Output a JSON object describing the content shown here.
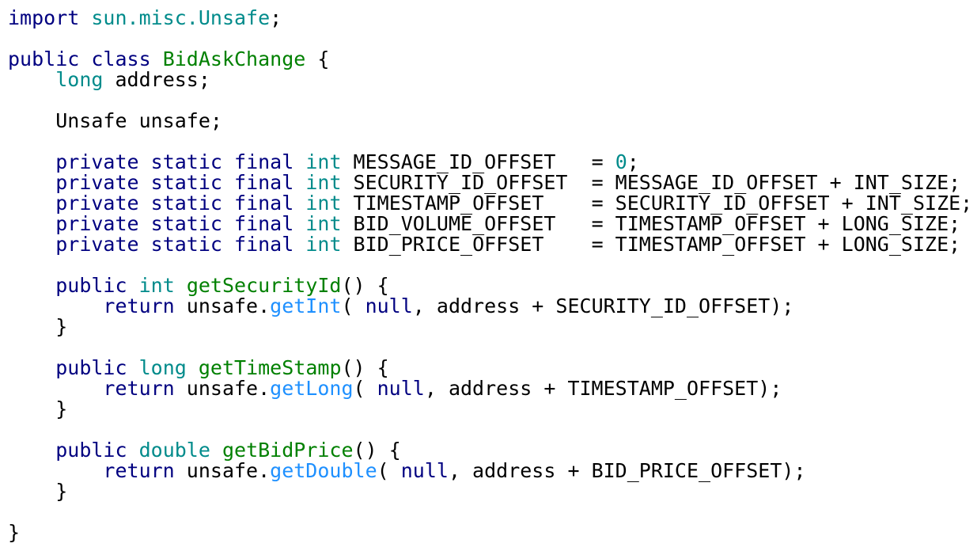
{
  "colors": {
    "keyword": "#000080",
    "type": "#008b8b",
    "class_name": "#008000",
    "method_name": "#008000",
    "call": "#1e90ff",
    "number": "#008b8b",
    "package": "#008b8b",
    "plain": "#000000",
    "background": "#ffffff"
  },
  "code_lines": [
    [
      {
        "t": "keyword",
        "v": "import"
      },
      {
        "t": "plain",
        "v": " "
      },
      {
        "t": "package",
        "v": "sun.misc.Unsafe"
      },
      {
        "t": "plain",
        "v": ";"
      }
    ],
    [],
    [
      {
        "t": "keyword",
        "v": "public"
      },
      {
        "t": "plain",
        "v": " "
      },
      {
        "t": "keyword",
        "v": "class"
      },
      {
        "t": "plain",
        "v": " "
      },
      {
        "t": "class",
        "v": "BidAskChange"
      },
      {
        "t": "plain",
        "v": " {"
      }
    ],
    [
      {
        "t": "plain",
        "v": "    "
      },
      {
        "t": "type",
        "v": "long"
      },
      {
        "t": "plain",
        "v": " address;"
      }
    ],
    [],
    [
      {
        "t": "plain",
        "v": "    Unsafe unsafe;"
      }
    ],
    [],
    [
      {
        "t": "plain",
        "v": "    "
      },
      {
        "t": "keyword",
        "v": "private"
      },
      {
        "t": "plain",
        "v": " "
      },
      {
        "t": "keyword",
        "v": "static"
      },
      {
        "t": "plain",
        "v": " "
      },
      {
        "t": "keyword",
        "v": "final"
      },
      {
        "t": "plain",
        "v": " "
      },
      {
        "t": "type",
        "v": "int"
      },
      {
        "t": "plain",
        "v": " MESSAGE_ID_OFFSET   = "
      },
      {
        "t": "number",
        "v": "0"
      },
      {
        "t": "plain",
        "v": ";"
      }
    ],
    [
      {
        "t": "plain",
        "v": "    "
      },
      {
        "t": "keyword",
        "v": "private"
      },
      {
        "t": "plain",
        "v": " "
      },
      {
        "t": "keyword",
        "v": "static"
      },
      {
        "t": "plain",
        "v": " "
      },
      {
        "t": "keyword",
        "v": "final"
      },
      {
        "t": "plain",
        "v": " "
      },
      {
        "t": "type",
        "v": "int"
      },
      {
        "t": "plain",
        "v": " SECURITY_ID_OFFSET  = MESSAGE_ID_OFFSET + INT_SIZE;"
      }
    ],
    [
      {
        "t": "plain",
        "v": "    "
      },
      {
        "t": "keyword",
        "v": "private"
      },
      {
        "t": "plain",
        "v": " "
      },
      {
        "t": "keyword",
        "v": "static"
      },
      {
        "t": "plain",
        "v": " "
      },
      {
        "t": "keyword",
        "v": "final"
      },
      {
        "t": "plain",
        "v": " "
      },
      {
        "t": "type",
        "v": "int"
      },
      {
        "t": "plain",
        "v": " TIMESTAMP_OFFSET    = SECURITY_ID_OFFSET + INT_SIZE;"
      }
    ],
    [
      {
        "t": "plain",
        "v": "    "
      },
      {
        "t": "keyword",
        "v": "private"
      },
      {
        "t": "plain",
        "v": " "
      },
      {
        "t": "keyword",
        "v": "static"
      },
      {
        "t": "plain",
        "v": " "
      },
      {
        "t": "keyword",
        "v": "final"
      },
      {
        "t": "plain",
        "v": " "
      },
      {
        "t": "type",
        "v": "int"
      },
      {
        "t": "plain",
        "v": " BID_VOLUME_OFFSET   = TIMESTAMP_OFFSET + LONG_SIZE;"
      }
    ],
    [
      {
        "t": "plain",
        "v": "    "
      },
      {
        "t": "keyword",
        "v": "private"
      },
      {
        "t": "plain",
        "v": " "
      },
      {
        "t": "keyword",
        "v": "static"
      },
      {
        "t": "plain",
        "v": " "
      },
      {
        "t": "keyword",
        "v": "final"
      },
      {
        "t": "plain",
        "v": " "
      },
      {
        "t": "type",
        "v": "int"
      },
      {
        "t": "plain",
        "v": " BID_PRICE_OFFSET    = TIMESTAMP_OFFSET + LONG_SIZE;"
      }
    ],
    [],
    [
      {
        "t": "plain",
        "v": "    "
      },
      {
        "t": "keyword",
        "v": "public"
      },
      {
        "t": "plain",
        "v": " "
      },
      {
        "t": "type",
        "v": "int"
      },
      {
        "t": "plain",
        "v": " "
      },
      {
        "t": "method",
        "v": "getSecurityId"
      },
      {
        "t": "plain",
        "v": "() {"
      }
    ],
    [
      {
        "t": "plain",
        "v": "        "
      },
      {
        "t": "keyword",
        "v": "return"
      },
      {
        "t": "plain",
        "v": " unsafe."
      },
      {
        "t": "call",
        "v": "getInt"
      },
      {
        "t": "plain",
        "v": "( "
      },
      {
        "t": "keyword",
        "v": "null"
      },
      {
        "t": "plain",
        "v": ", address + SECURITY_ID_OFFSET);"
      }
    ],
    [
      {
        "t": "plain",
        "v": "    }"
      }
    ],
    [],
    [
      {
        "t": "plain",
        "v": "    "
      },
      {
        "t": "keyword",
        "v": "public"
      },
      {
        "t": "plain",
        "v": " "
      },
      {
        "t": "type",
        "v": "long"
      },
      {
        "t": "plain",
        "v": " "
      },
      {
        "t": "method",
        "v": "getTimeStamp"
      },
      {
        "t": "plain",
        "v": "() {"
      }
    ],
    [
      {
        "t": "plain",
        "v": "        "
      },
      {
        "t": "keyword",
        "v": "return"
      },
      {
        "t": "plain",
        "v": " unsafe."
      },
      {
        "t": "call",
        "v": "getLong"
      },
      {
        "t": "plain",
        "v": "( "
      },
      {
        "t": "keyword",
        "v": "null"
      },
      {
        "t": "plain",
        "v": ", address + TIMESTAMP_OFFSET);"
      }
    ],
    [
      {
        "t": "plain",
        "v": "    }"
      }
    ],
    [],
    [
      {
        "t": "plain",
        "v": "    "
      },
      {
        "t": "keyword",
        "v": "public"
      },
      {
        "t": "plain",
        "v": " "
      },
      {
        "t": "type",
        "v": "double"
      },
      {
        "t": "plain",
        "v": " "
      },
      {
        "t": "method",
        "v": "getBidPrice"
      },
      {
        "t": "plain",
        "v": "() {"
      }
    ],
    [
      {
        "t": "plain",
        "v": "        "
      },
      {
        "t": "keyword",
        "v": "return"
      },
      {
        "t": "plain",
        "v": " unsafe."
      },
      {
        "t": "call",
        "v": "getDouble"
      },
      {
        "t": "plain",
        "v": "( "
      },
      {
        "t": "keyword",
        "v": "null"
      },
      {
        "t": "plain",
        "v": ", address + BID_PRICE_OFFSET);"
      }
    ],
    [
      {
        "t": "plain",
        "v": "    }"
      }
    ],
    [],
    [
      {
        "t": "plain",
        "v": "}"
      }
    ]
  ]
}
